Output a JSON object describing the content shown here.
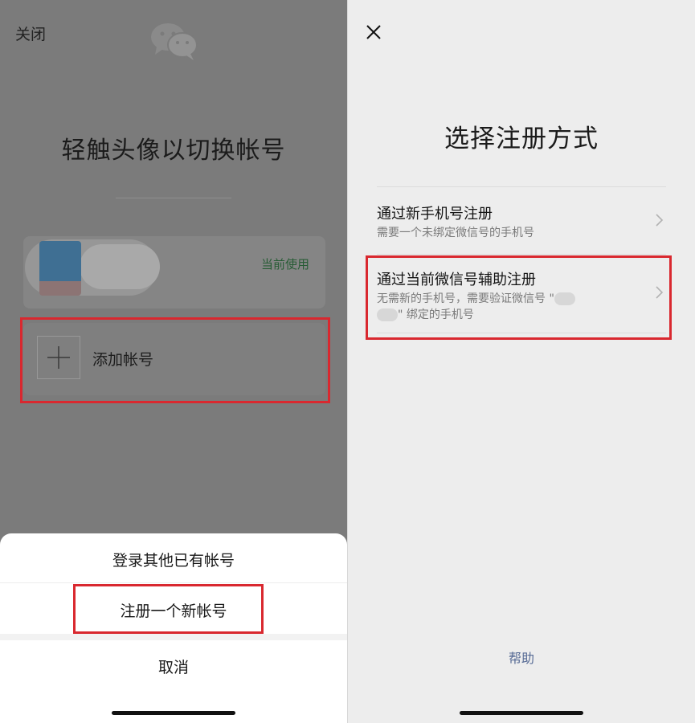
{
  "left": {
    "close_label": "关闭",
    "title": "轻触头像以切换帐号",
    "account": {
      "status": "当前使用"
    },
    "add_account_label": "添加帐号",
    "sheet": {
      "login_other": "登录其他已有帐号",
      "register_new": "注册一个新帐号",
      "cancel": "取消"
    }
  },
  "right": {
    "title": "选择注册方式",
    "options": [
      {
        "title": "通过新手机号注册",
        "subtitle": "需要一个未绑定微信号的手机号"
      },
      {
        "title": "通过当前微信号辅助注册",
        "subtitle_part1": "无需新的手机号，需要验证微信号 \"",
        "subtitle_part2": "\" 绑定的手机号"
      }
    ],
    "help": "帮助"
  },
  "colors": {
    "highlight": "#d9282f",
    "current_green": "#275c35",
    "link_blue": "#576b95"
  }
}
